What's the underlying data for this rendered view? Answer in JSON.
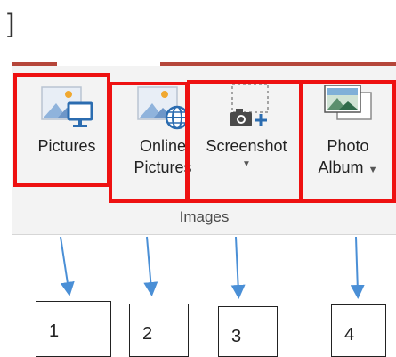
{
  "ribbon": {
    "group_label": "Images",
    "buttons": [
      {
        "label": "Pictures",
        "icon": "pictures-icon"
      },
      {
        "label_lines": [
          "Online",
          "Pictures"
        ],
        "icon": "online-pictures-icon"
      },
      {
        "label": "Screenshot",
        "icon": "screenshot-icon",
        "has_dropdown": true
      },
      {
        "label_lines": [
          "Photo",
          "Album"
        ],
        "icon": "photo-album-icon",
        "has_dropdown": true
      }
    ]
  },
  "callouts": [
    "1",
    "2",
    "3",
    "4"
  ],
  "colors": {
    "highlight": "#ee1111",
    "arrow": "#4a8fd6",
    "tab_accent": "#b5463a",
    "icon_blue": "#2b6cb0",
    "icon_orange": "#f0a830"
  }
}
